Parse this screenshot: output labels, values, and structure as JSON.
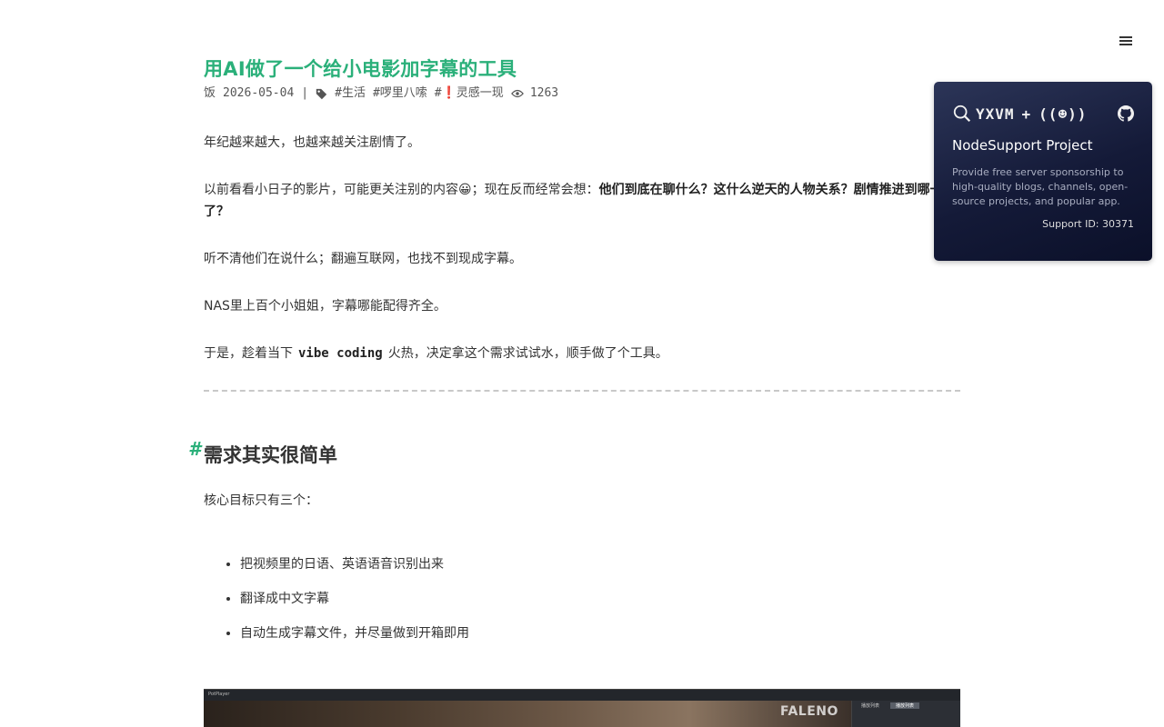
{
  "nav": {
    "menu_icon": "hamburger-icon"
  },
  "post": {
    "title": "用AI做了一个给小电影加字幕的工具",
    "author": "饭",
    "date": "2026-05-04",
    "separator": "|",
    "tags": [
      "#生活",
      "#啰里八嗦",
      "#"
    ],
    "tag_special_emoji": "❗",
    "tag_special_text": "灵感一现",
    "views": "1263"
  },
  "content": {
    "p1": "年纪越来越大，也越来越关注剧情了。",
    "p2_a": "以前看看小日子的影片，可能更关注别的内容😀；现在反而经常会想：",
    "p2_b": "他们到底在聊什么？这什么逆天的人物关系？剧情推进到哪一了？",
    "p3": "听不清他们在说什么；翻遍互联网，也找不到现成字幕。",
    "p4": "NAS里上百个小姐姐，字幕哪能配得齐全。",
    "p5_a": "于是，趁着当下",
    "p5_code": "vibe coding",
    "p5_b": "火热，决定拿这个需求试试水，顺手做了个工具。"
  },
  "section": {
    "hash": "#",
    "heading": "需求其实很简单",
    "lead": "核心目标只有三个：",
    "items": [
      "把视频里的日语、英语语音识别出来",
      "翻译成中文字幕",
      "自动生成字幕文件，并尽量做到开箱即用"
    ]
  },
  "screenshot": {
    "app_label": "PotPlayer",
    "watermark": "FALENO",
    "tabs": [
      "播放列表",
      "播放列表"
    ]
  },
  "sponsor": {
    "logo_text": "YXVM",
    "plus": "+",
    "logo_right": "((☻))",
    "title": "NodeSupport Project",
    "description": "Provide free server sponsorship to high-quality blogs, channels, open-source projects, and popular app.",
    "support_id": "Support ID: 30371"
  },
  "colors": {
    "accent": "#2bb07a",
    "sponsor_bg": "#141a38"
  }
}
